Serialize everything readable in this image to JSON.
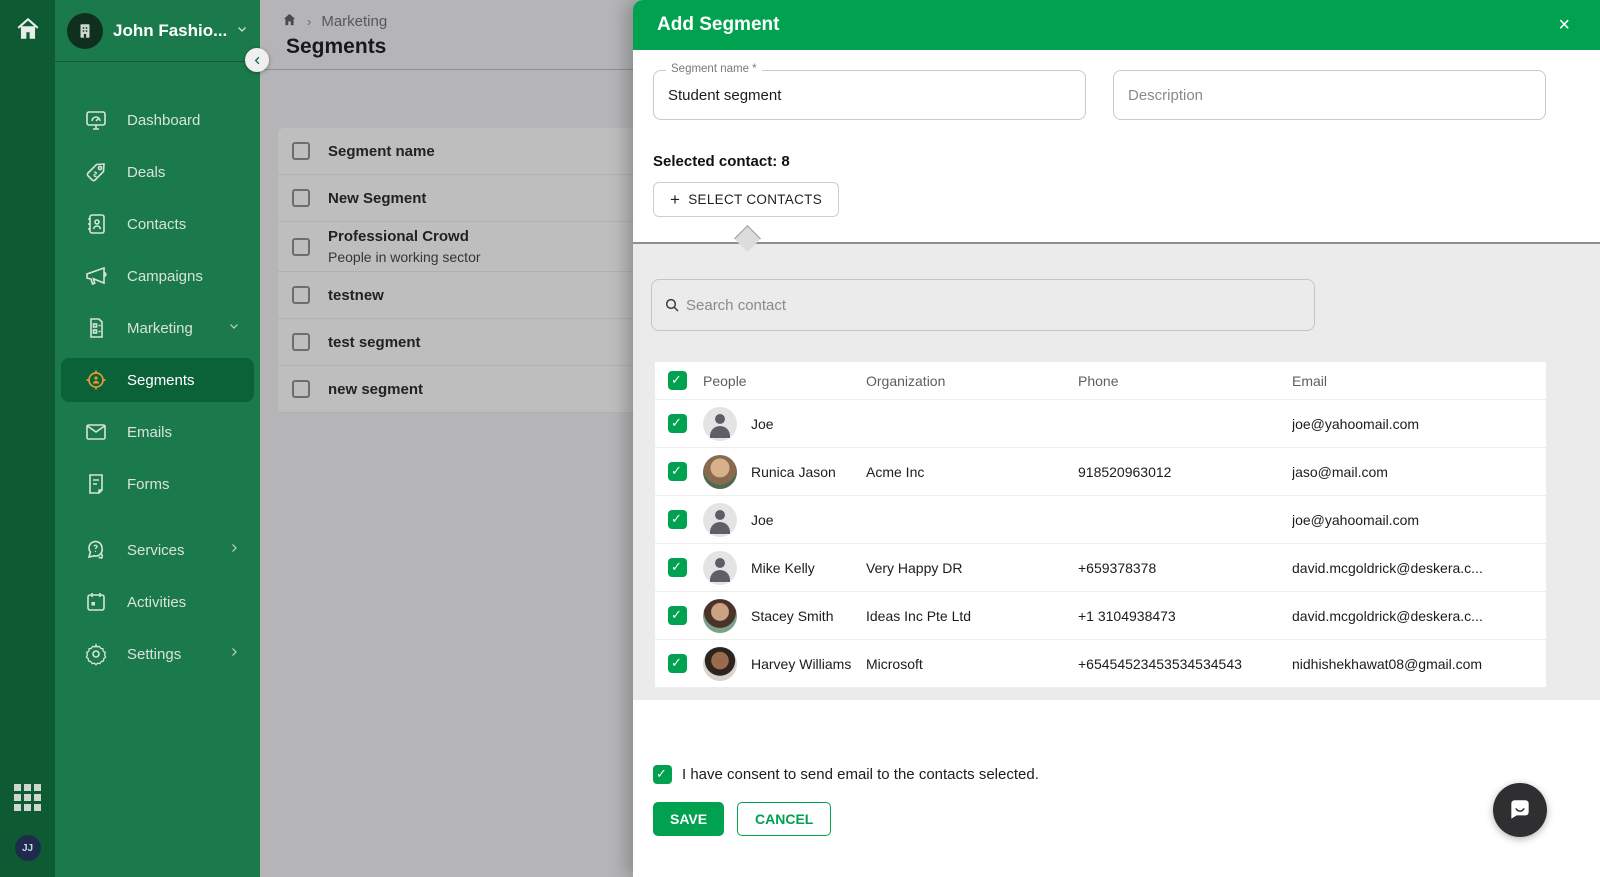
{
  "colors": {
    "accent_green": "#00a14f",
    "sidebar_green": "#1b7a4b",
    "rail_green": "#0d5a33",
    "active_item_green": "#0c6238",
    "segments_icon_orange": "#e19b36"
  },
  "rail": {
    "home_icon": "home-icon",
    "apps_icon": "grid-apps-icon",
    "avatar_initials": "JJ"
  },
  "sidebar": {
    "workspace_name": "John Fashio...",
    "workspace_icon": "building-icon",
    "items": [
      {
        "label": "Dashboard",
        "icon": "dashboard-icon"
      },
      {
        "label": "Deals",
        "icon": "deals-tag-icon"
      },
      {
        "label": "Contacts",
        "icon": "contacts-book-icon"
      },
      {
        "label": "Campaigns",
        "icon": "campaigns-megaphone-icon"
      },
      {
        "label": "Marketing",
        "icon": "marketing-doc-icon",
        "chevron": "down"
      },
      {
        "label": "Segments",
        "icon": "segments-target-icon",
        "active": true
      },
      {
        "label": "Emails",
        "icon": "emails-envelope-icon"
      },
      {
        "label": "Forms",
        "icon": "forms-page-icon"
      },
      {
        "label": "Services",
        "icon": "services-chat-icon",
        "chevron": "right"
      },
      {
        "label": "Activities",
        "icon": "activities-calendar-icon"
      },
      {
        "label": "Settings",
        "icon": "settings-gear-icon",
        "chevron": "right"
      }
    ]
  },
  "breadcrumb": {
    "home_icon": "home-icon",
    "path": "Marketing",
    "title": "Segments"
  },
  "segments_table": {
    "header": "Segment name",
    "rows": [
      {
        "name": "New Segment",
        "desc": ""
      },
      {
        "name": "Professional Crowd",
        "desc": "People in working sector"
      },
      {
        "name": "testnew",
        "desc": ""
      },
      {
        "name": "test segment",
        "desc": ""
      },
      {
        "name": "new segment",
        "desc": ""
      }
    ]
  },
  "modal": {
    "title": "Add Segment",
    "close_glyph": "×",
    "segment_name_label": "Segment name *",
    "segment_name_value": "Student segment",
    "description_placeholder": "Description",
    "selected_contact": "Selected contact: 8",
    "select_contacts_plus": "+",
    "select_contacts_label": "SELECT CONTACTS",
    "search_placeholder": "Search contact",
    "contacts": {
      "columns": [
        "People",
        "Organization",
        "Phone",
        "Email"
      ],
      "rows": [
        {
          "name": "Joe",
          "org": "",
          "phone": "",
          "email": "joe@yahoomail.com",
          "avatar": "person-silhouette"
        },
        {
          "name": "Runica Jason",
          "org": "Acme Inc",
          "phone": "918520963012",
          "email": "jaso@mail.com",
          "avatar": "photo"
        },
        {
          "name": "Joe",
          "org": "",
          "phone": "",
          "email": "joe@yahoomail.com",
          "avatar": "person-silhouette"
        },
        {
          "name": "Mike Kelly",
          "org": "Very Happy DR",
          "phone": "+659378378",
          "email": "david.mcgoldrick@deskera.c...",
          "avatar": "person-silhouette"
        },
        {
          "name": "Stacey Smith",
          "org": "Ideas Inc Pte Ltd",
          "phone": "+1 3104938473",
          "email": "david.mcgoldrick@deskera.c...",
          "avatar": "photo"
        },
        {
          "name": "Harvey Williams",
          "org": "Microsoft",
          "phone": "+65454523453534534543",
          "email": "nidhishekhawat08@gmail.com",
          "avatar": "photo"
        }
      ]
    },
    "consent_label": "I have consent to send email to the contacts selected.",
    "save_label": "SAVE",
    "cancel_label": "CANCEL"
  }
}
